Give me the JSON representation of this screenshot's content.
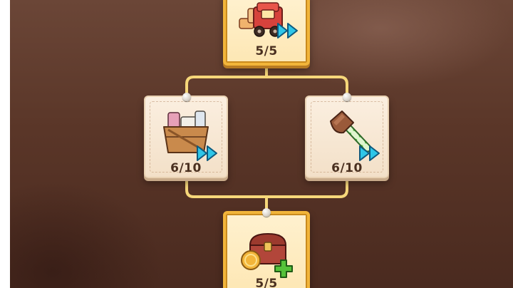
{
  "upgrade_tree": {
    "top_node": {
      "item": "toy-train",
      "progress": "5/5",
      "badge": "fast-forward-arrows"
    },
    "left_node": {
      "item": "crate-of-supplies",
      "progress": "6/10",
      "badge": "fast-forward-arrows"
    },
    "right_node": {
      "item": "axe",
      "progress": "6/10",
      "badge": "fast-forward-arrows"
    },
    "bottom_node": {
      "item": "treasure-chest-with-coin",
      "progress": "5/5",
      "badge": "plus"
    }
  },
  "colors": {
    "background": "#5a3628",
    "gold_border": "#f2b53a",
    "connector": "#f6d77a",
    "count_text": "#4a3020",
    "badge_cyan": "#2ec6e8",
    "badge_green": "#55c23a"
  }
}
